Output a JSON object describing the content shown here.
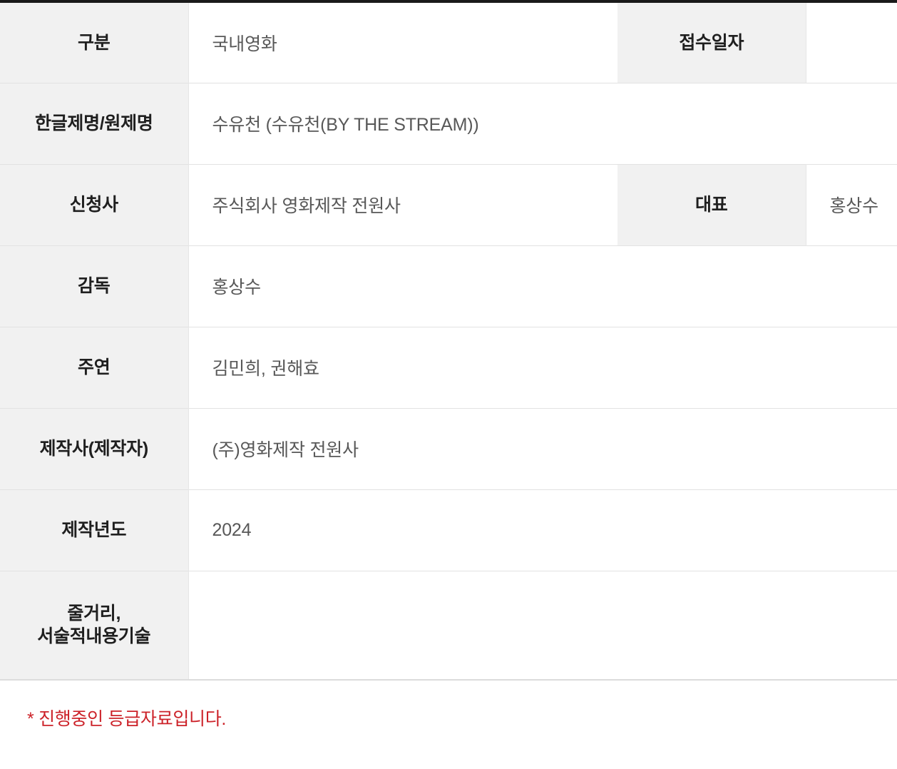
{
  "table": {
    "rows": [
      {
        "label": "구분",
        "value": "국내영화",
        "label2": "접수일자",
        "value2": ""
      },
      {
        "label": "한글제명/원제명",
        "value": "수유천  (수유천(BY THE STREAM))",
        "span": true
      },
      {
        "label": "신청사",
        "value": "주식회사 영화제작 전원사",
        "label2": "대표",
        "value2": "홍상수"
      },
      {
        "label": "감독",
        "value": "홍상수",
        "span": true
      },
      {
        "label": "주연",
        "value": "김민희, 권해효",
        "span": true
      },
      {
        "label": "제작사(제작자)",
        "value": "(주)영화제작 전원사",
        "span": true
      },
      {
        "label": "제작년도",
        "value": "2024",
        "span": true
      }
    ],
    "synopsis": {
      "label_line1": "줄거리,",
      "label_line2": "서술적내용기술",
      "value": ""
    }
  },
  "footnote": {
    "text": "* 진행중인 등급자료입니다.",
    "color": "#cc2229"
  }
}
